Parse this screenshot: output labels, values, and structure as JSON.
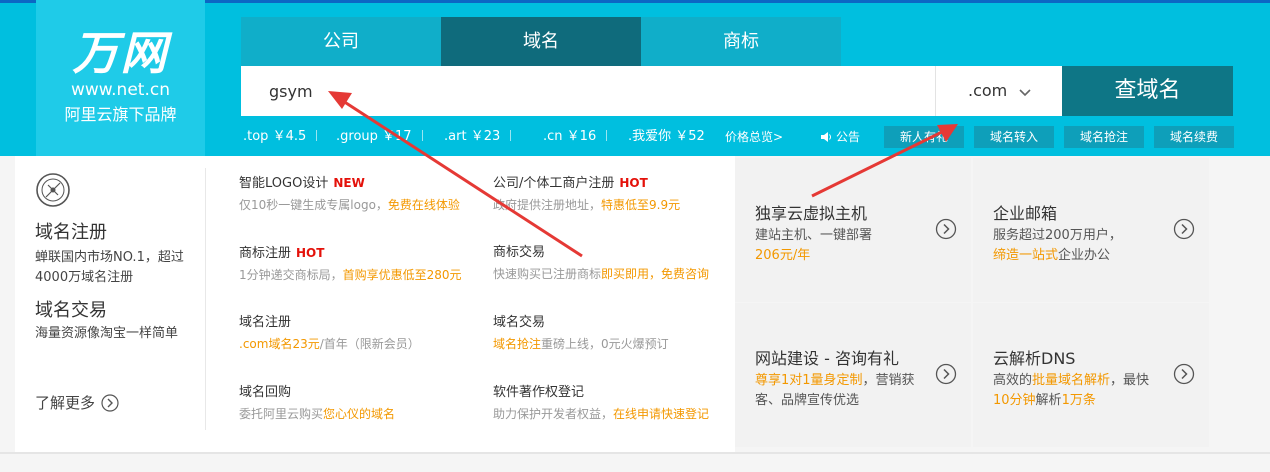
{
  "logo": {
    "mark": "万网",
    "url": "www.net.cn",
    "tagline": "阿里云旗下品牌"
  },
  "tabs": [
    {
      "label": "公司"
    },
    {
      "label": "域名"
    },
    {
      "label": "商标"
    }
  ],
  "search": {
    "value": "gsym",
    "suffix": ".com",
    "button": "查域名"
  },
  "prices": [
    {
      "suffix": ".top",
      "price": "￥4.5"
    },
    {
      "suffix": ".group",
      "price": "￥17"
    },
    {
      "suffix": ".art",
      "price": "￥23"
    },
    {
      "suffix": ".cn",
      "price": "￥16"
    },
    {
      "suffix": ".我爱你",
      "price": "￥52"
    }
  ],
  "price_all": "价格总览>",
  "notice": "公告",
  "quick_buttons": [
    "新人有礼",
    "域名转入",
    "域名抢注",
    "域名续费"
  ],
  "left_panel": {
    "title1": "域名注册",
    "desc1": "蝉联国内市场NO.1，超过4000万域名注册",
    "title2": "域名交易",
    "desc2": "海量资源像淘宝一样简单",
    "learn_more": "了解更多"
  },
  "services": [
    {
      "title": "智能LOGO设计",
      "tag": "NEW",
      "desc_plain": "仅10秒一键生成专属logo，",
      "desc_hl": "免费在线体验",
      "desc_tail": ""
    },
    {
      "title": "公司/个体工商户注册",
      "tag": "HOT",
      "desc_plain": "政府提供注册地址，",
      "desc_hl": "特惠低至9.9元",
      "desc_tail": ""
    },
    {
      "title": "商标注册",
      "tag": "HOT",
      "desc_plain": "1分钟递交商标局，",
      "desc_hl": "首购享优惠低至280元",
      "desc_tail": ""
    },
    {
      "title": "商标交易",
      "tag": "",
      "desc_plain": "快速购买已注册商标",
      "desc_hl": "即买即用，免费咨询",
      "desc_tail": ""
    },
    {
      "title": "域名注册",
      "tag": "",
      "desc_plain": "",
      "desc_hl": ".com域名23元",
      "desc_tail": "/首年（限新会员）"
    },
    {
      "title": "域名交易",
      "tag": "",
      "desc_plain": "",
      "desc_hl": "域名抢注",
      "desc_tail": "重磅上线，0元火爆预订"
    },
    {
      "title": "域名回购",
      "tag": "",
      "desc_plain": "委托阿里云购买",
      "desc_hl": "您心仪的域名",
      "desc_tail": ""
    },
    {
      "title": "软件著作权登记",
      "tag": "",
      "desc_plain": "助力保护开发者权益，",
      "desc_hl": "在线申请快速登记",
      "desc_tail": ""
    }
  ],
  "promos": [
    {
      "title": "独享云虚拟主机",
      "line1": "建站主机、一键部署",
      "line2_hl": "206元/年",
      "line2": ""
    },
    {
      "title": "企业邮箱",
      "line1": "服务超过200万用户，",
      "line2_hl": "缔造一站式",
      "line2": "企业办公"
    },
    {
      "title": "网站建设 - 咨询有礼",
      "line1_hl": "尊享1对1量身定制",
      "line1": "，营销获客、品牌宣传优选"
    },
    {
      "title": "云解析DNS",
      "line1": "高效的",
      "line1_hl": "批量域名解析",
      "line1_tail": "，最快",
      "line2_hl": "10分钟",
      "line2": "解析",
      "line2_hl2": "1万条"
    }
  ],
  "colors": {
    "header": "#00bfdf",
    "active_tab": "#0f6b7c",
    "search_button": "#0e7686",
    "highlight": "#f39800",
    "tag": "#e4110a",
    "annotation_arrow": "#e53935"
  }
}
